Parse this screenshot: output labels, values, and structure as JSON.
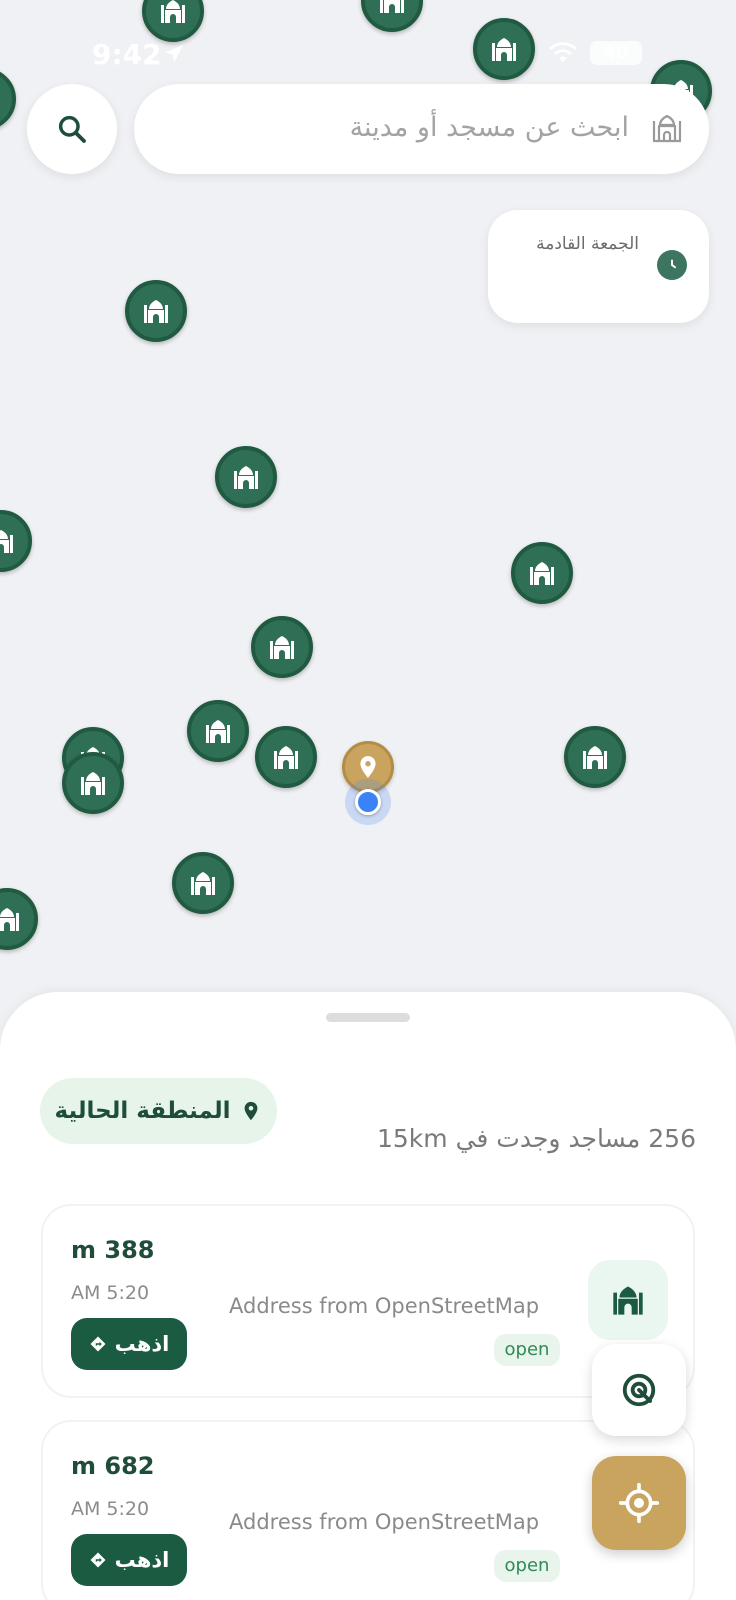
{
  "status_bar": {
    "time": "9:42",
    "battery": "40"
  },
  "search": {
    "placeholder": "ابحث عن مسجد أو مدينة"
  },
  "prayer_card": {
    "label": "الجمعة القادمة"
  },
  "sheet": {
    "area_label": "المنطقة الحالية",
    "count_text": "256 مساجد وجدت في 15km"
  },
  "mosques": [
    {
      "distance": "m 388",
      "prayer_time": "AM 5:20",
      "address": "Address from OpenStreetMap",
      "status": "open",
      "go_label": "اذهب"
    },
    {
      "distance": "m 682",
      "prayer_time": "AM 5:20",
      "address": "Address from OpenStreetMap",
      "status": "open",
      "go_label": "اذهب"
    }
  ],
  "colors": {
    "primary_green": "#1b5b41",
    "marker_green": "#2f6f55",
    "accent_gold": "#c9a45e",
    "chip_bg": "#e6f4ea",
    "user_blue": "#3b82f6"
  },
  "icons": {
    "search": "search-icon",
    "mosque": "mosque-icon",
    "clock": "clock-icon",
    "location_pin": "location-pin-icon",
    "radius": "radius-icon",
    "locate": "crosshair-icon"
  }
}
